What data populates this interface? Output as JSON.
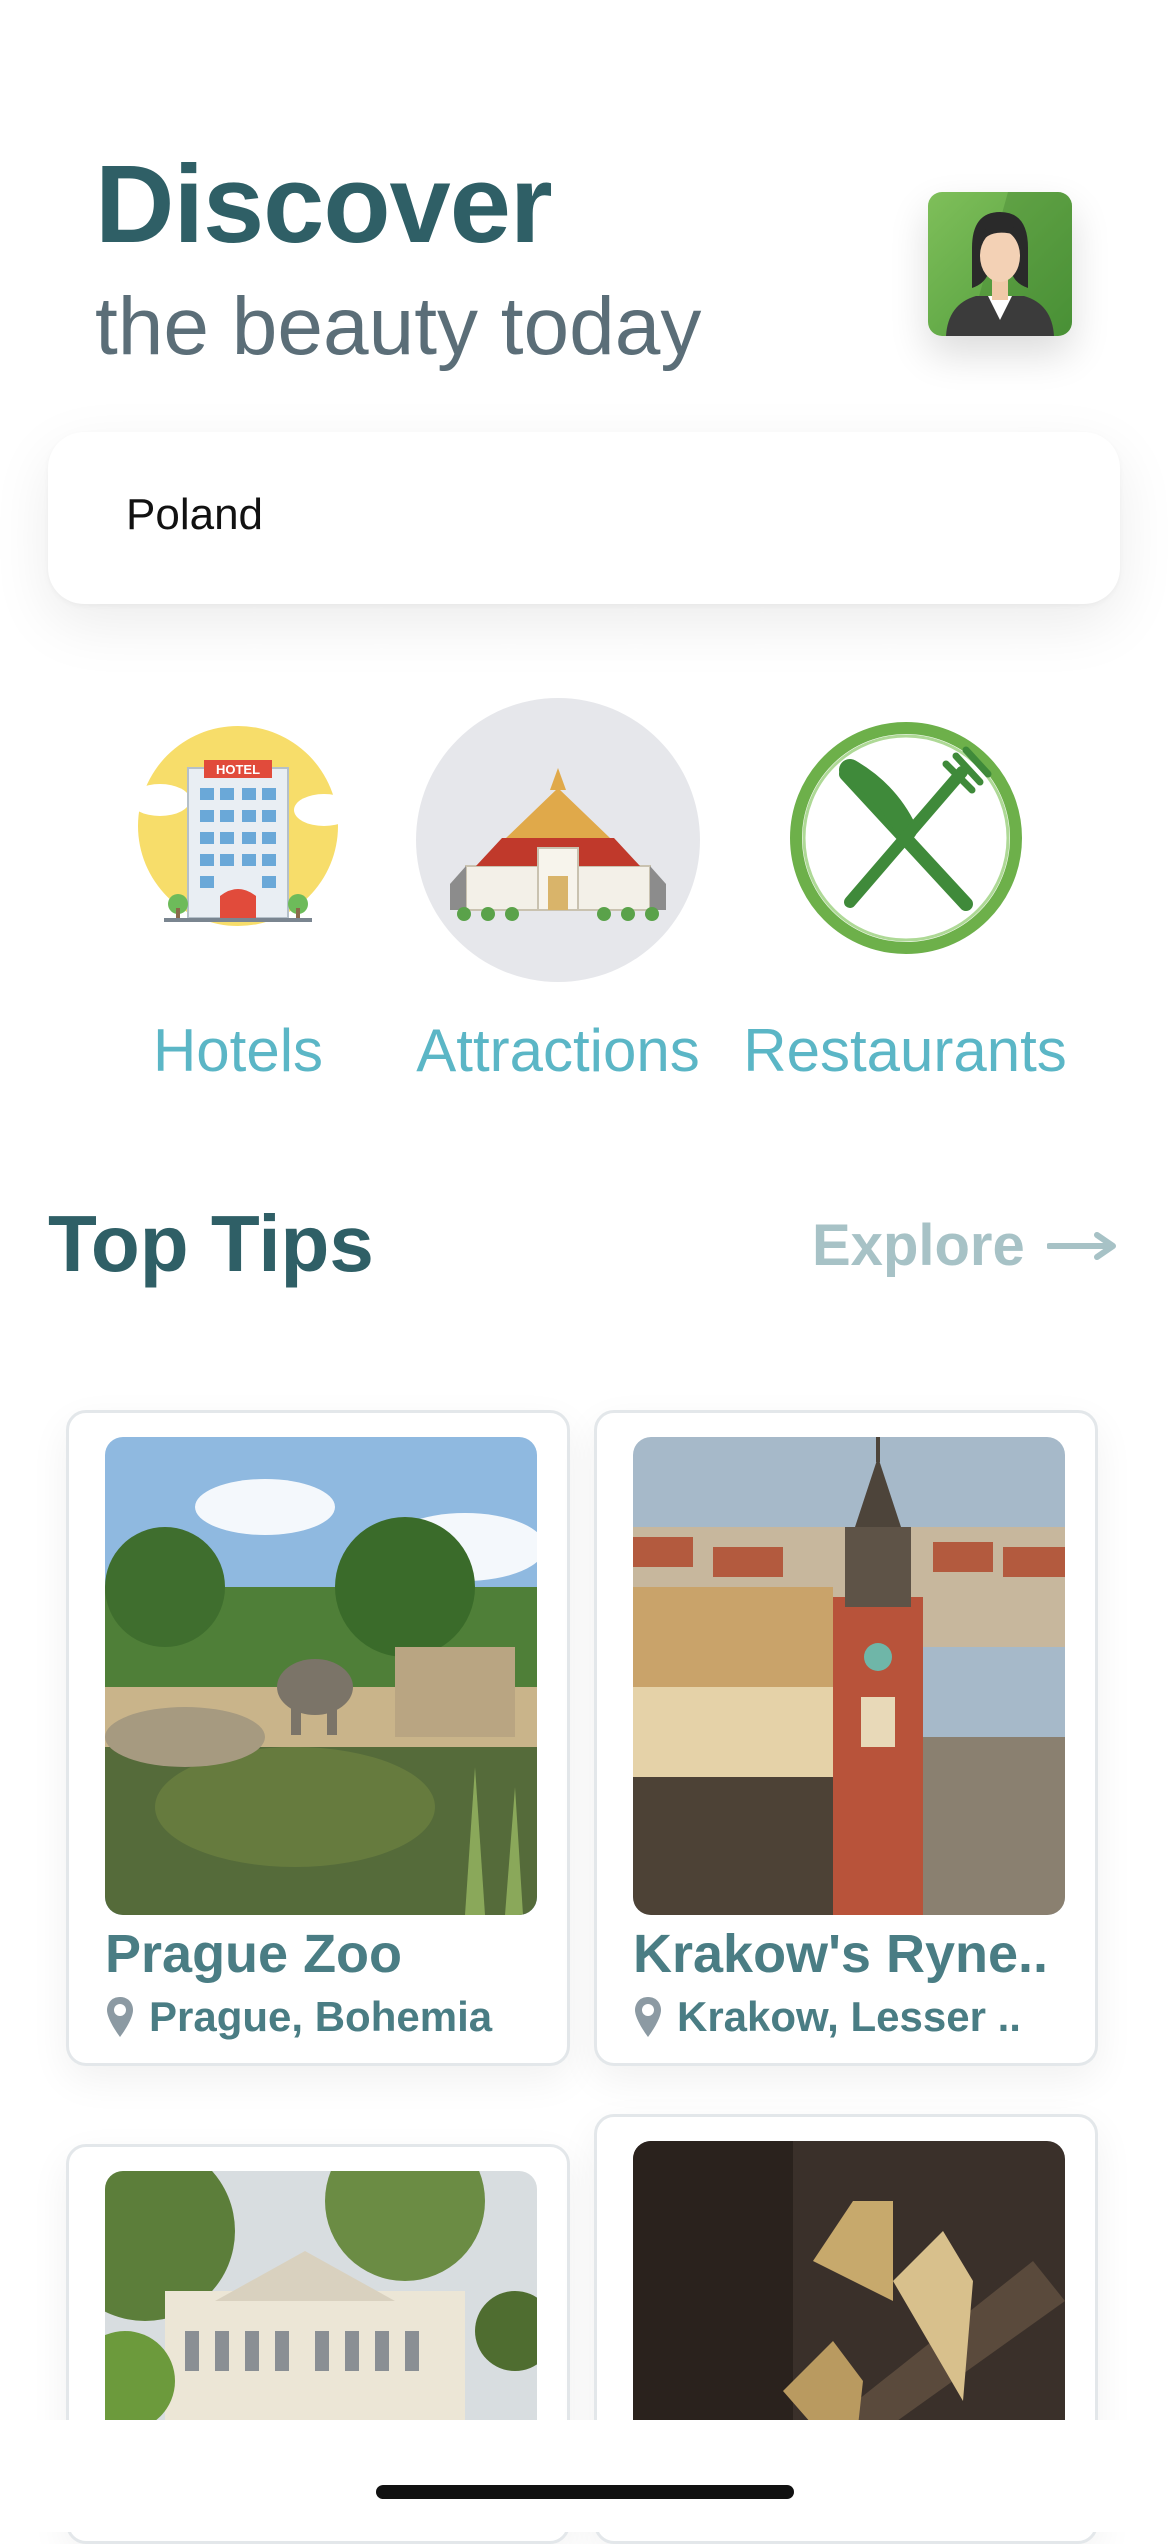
{
  "header": {
    "title": "Discover",
    "subtitle": "the beauty today"
  },
  "search": {
    "value": "Poland"
  },
  "categories": [
    {
      "label": "Hotels",
      "icon": "hotel-icon"
    },
    {
      "label": "Attractions",
      "icon": "temple-icon"
    },
    {
      "label": "Restaurants",
      "icon": "fork-knife-icon"
    }
  ],
  "section": {
    "title": "Top Tips",
    "explore_label": "Explore"
  },
  "cards": [
    {
      "title": "Prague Zoo",
      "location": "Prague, Bohemia"
    },
    {
      "title": "Krakow's Ryne..",
      "location": "Krakow, Lesser .."
    },
    {
      "title": "",
      "location": ""
    },
    {
      "title": "",
      "location": ""
    }
  ],
  "colors": {
    "title_teal": "#2f5f66",
    "category_cyan": "#5bb6c6",
    "card_text": "#4a7d84",
    "explore_gray": "#a7c2c6"
  }
}
